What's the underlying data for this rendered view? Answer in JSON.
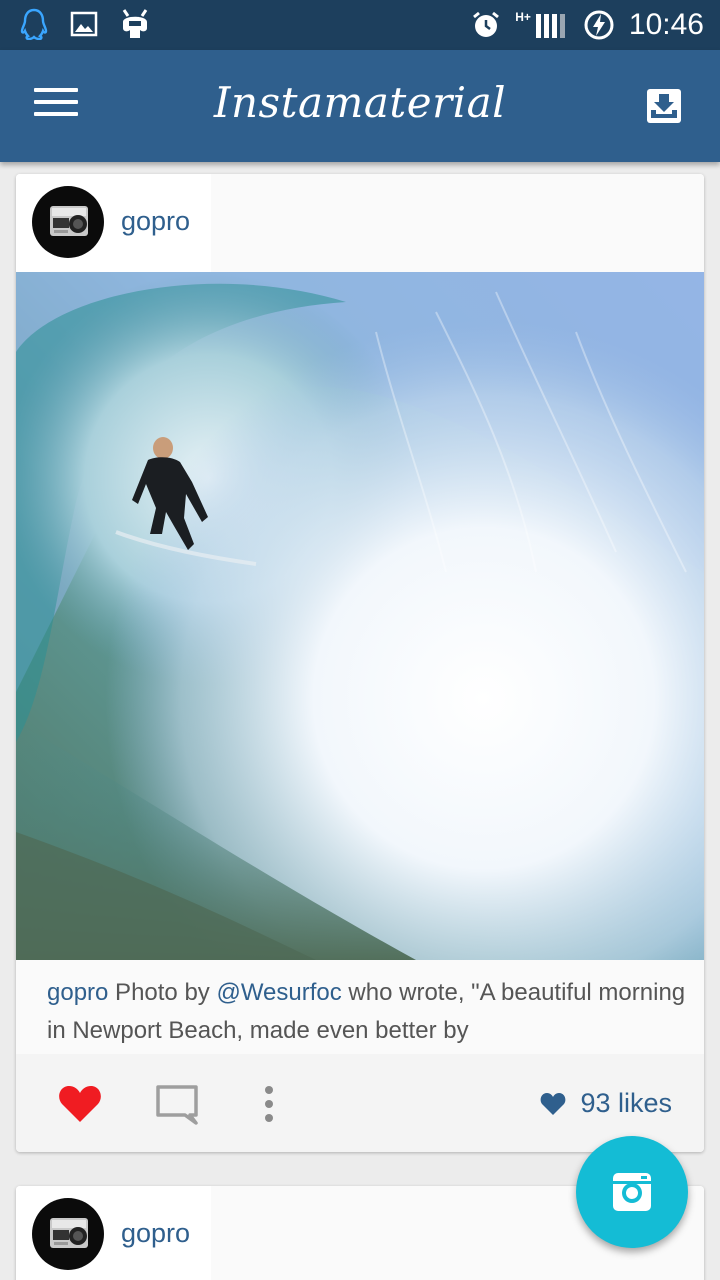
{
  "status_bar": {
    "time": "10:46",
    "network": "H+",
    "icons": [
      "qq-icon",
      "gallery-icon",
      "cyanogen-icon",
      "alarm-icon",
      "signal-icon",
      "battery-charging-icon"
    ]
  },
  "app_bar": {
    "title": "Instamaterial",
    "menu_icon": "hamburger-menu-icon",
    "inbox_icon": "inbox-download-icon",
    "color": "#2f5f8d"
  },
  "feed": {
    "posts": [
      {
        "username": "gopro",
        "caption_user": "gopro",
        "caption_pre": " Photo by ",
        "caption_mention": "@Wesurfoc",
        "caption_post": " who wrote, \"A beautiful morning in Newport Beach, made even better by",
        "liked": true,
        "likes_text": "93 likes"
      },
      {
        "username": "gopro"
      }
    ]
  },
  "fab": {
    "icon": "camera-icon",
    "color": "#14bcd5"
  },
  "colors": {
    "accent": "#2f5f8d",
    "like": "#f01c22",
    "fab": "#14bcd5"
  }
}
